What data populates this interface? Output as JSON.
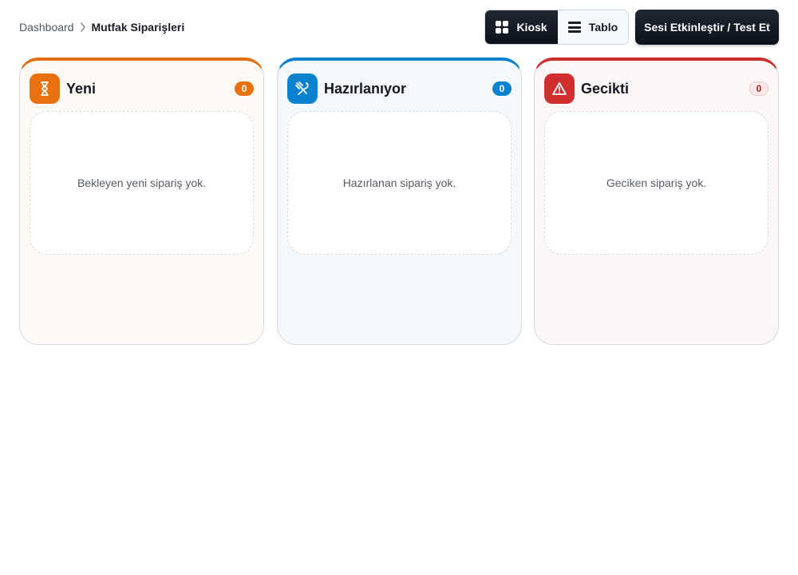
{
  "breadcrumb": {
    "parent": "Dashboard",
    "current": "Mutfak Siparişleri"
  },
  "view_toggle": {
    "kiosk_label": "Kiosk",
    "tablo_label": "Tablo",
    "active": "Kiosk"
  },
  "sound_button": {
    "label": "Sesi Etkinleştir / Test Et"
  },
  "columns": [
    {
      "title": "Yeni",
      "count": "0",
      "icon": "hourglass-icon",
      "empty_text": "Bekleyen yeni sipariş yok.",
      "accent": "#e0700f"
    },
    {
      "title": "Hazırlanıyor",
      "count": "0",
      "icon": "utensils-icon",
      "empty_text": "Hazırlanan sipariş yok.",
      "accent": "#0a7fcc"
    },
    {
      "title": "Gecikti",
      "count": "0",
      "icon": "warning-icon",
      "empty_text": "Geciken sipariş yok.",
      "accent": "#cc2e2e"
    }
  ]
}
